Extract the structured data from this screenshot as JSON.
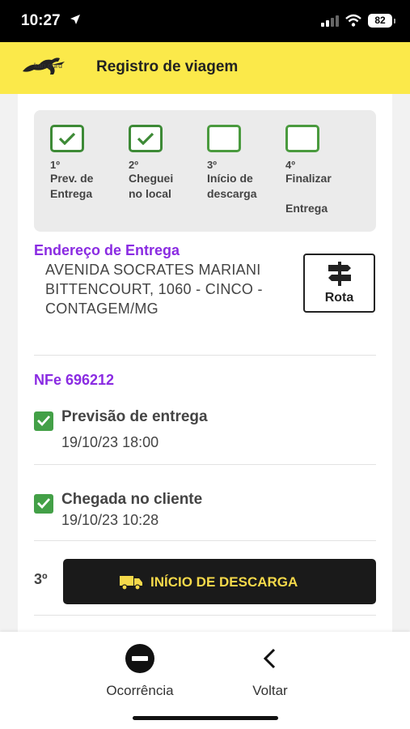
{
  "status_bar": {
    "time": "10:27",
    "battery": "82"
  },
  "app_bar": {
    "logo_text": "kan.guru",
    "title": "Registro de viagem"
  },
  "steps": [
    {
      "number": "1º",
      "label_line1": "Prev. de",
      "label_line2": "Entrega",
      "checked": true
    },
    {
      "number": "2º",
      "label_line1": "Cheguei",
      "label_line2": "no local",
      "checked": true
    },
    {
      "number": "3º",
      "label_line1": "Início de",
      "label_line2": "descarga",
      "checked": false
    },
    {
      "number": "4º",
      "label_line1": "Finalizar",
      "label_line2": "Entrega",
      "checked": false
    }
  ],
  "address": {
    "title": "Endereço de Entrega",
    "text": "AVENIDA SOCRATES MARIANI BITTENCOURT, 1060 - CINCO - CONTAGEM/MG",
    "route_label": "Rota"
  },
  "nfe": {
    "label": "NFe 696212"
  },
  "events": [
    {
      "title": "Previsão de entrega",
      "date": "19/10/23 18:00",
      "checked": true
    },
    {
      "title": "Chegada no cliente",
      "date": "19/10/23 10:28",
      "checked": true
    }
  ],
  "action": {
    "step_number": "3º",
    "button_label": "INÍCIO DE DESCARGA"
  },
  "bottom_nav": {
    "occurrence_label": "Ocorrência",
    "back_label": "Voltar"
  },
  "colors": {
    "accent_yellow": "#fbe94a",
    "purple": "#8a2be2",
    "green": "#43a047",
    "dark": "#1a1a1a"
  },
  "icons": [
    "location-arrow-icon",
    "signal-icon",
    "wifi-icon",
    "check-icon",
    "signpost-icon",
    "truck-icon",
    "no-entry-icon",
    "chevron-left-icon"
  ]
}
